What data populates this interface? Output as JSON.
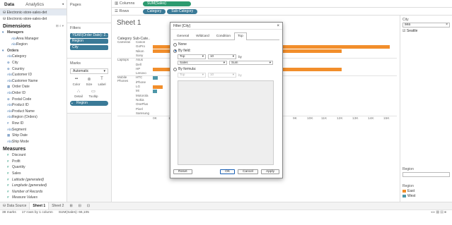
{
  "data_pane": {
    "tabs": [
      "Data",
      "Analytics"
    ],
    "datasources": [
      "Electronic-store-sales-det",
      "Electronic-store-sales-det"
    ],
    "dimensions_title": "Dimensions",
    "dimensions_tools": "⊞ ⌕ ▾",
    "dimension_fields": [
      {
        "label": "Managers",
        "kind": "group",
        "icon": "▾"
      },
      {
        "label": "Area Manager",
        "kind": "sub",
        "icon": "Abc"
      },
      {
        "label": "Region",
        "kind": "sub",
        "icon": "Abc"
      },
      {
        "label": "Orders",
        "kind": "group",
        "icon": "▾"
      },
      {
        "label": "Category",
        "kind": "field",
        "icon": "Abc"
      },
      {
        "label": "City",
        "kind": "field",
        "icon": "⊕"
      },
      {
        "label": "Country",
        "kind": "field",
        "icon": "⊕"
      },
      {
        "label": "Customer ID",
        "kind": "field",
        "icon": "Abc"
      },
      {
        "label": "Customer Name",
        "kind": "field",
        "icon": "Abc"
      },
      {
        "label": "Order Date",
        "kind": "field",
        "icon": "▦"
      },
      {
        "label": "Order ID",
        "kind": "field",
        "icon": "Abc"
      },
      {
        "label": "Postal Code",
        "kind": "field",
        "icon": "⊕"
      },
      {
        "label": "Product ID",
        "kind": "field",
        "icon": "Abc"
      },
      {
        "label": "Product Name",
        "kind": "field",
        "icon": "Abc"
      },
      {
        "label": "Region (Orders)",
        "kind": "field",
        "icon": "Abc"
      },
      {
        "label": "Row ID",
        "kind": "field",
        "icon": "#"
      },
      {
        "label": "Segment",
        "kind": "field",
        "icon": "Abc"
      },
      {
        "label": "Ship Date",
        "kind": "field",
        "icon": "▦"
      },
      {
        "label": "Ship Mode",
        "kind": "field",
        "icon": "Abc"
      }
    ],
    "measures_title": "Measures",
    "measure_fields": [
      {
        "label": "Discount",
        "italic": false
      },
      {
        "label": "Profit",
        "italic": false
      },
      {
        "label": "Quantity",
        "italic": false
      },
      {
        "label": "Sales",
        "italic": false
      },
      {
        "label": "Latitude (generated)",
        "italic": true
      },
      {
        "label": "Longitude (generated)",
        "italic": true
      },
      {
        "label": "Number of Records",
        "italic": true
      },
      {
        "label": "Measure Values",
        "italic": true
      }
    ]
  },
  "pages": {
    "title": "Pages"
  },
  "filters": {
    "title": "Filters",
    "pills": [
      "YEAR(Order Date): 2..",
      "Region",
      "City"
    ]
  },
  "marks": {
    "title": "Marks",
    "type": "Automatic",
    "buttons": [
      {
        "label": "Color",
        "icon": "▪▪"
      },
      {
        "label": "Size",
        "icon": "⊚"
      },
      {
        "label": "Label",
        "icon": "T"
      },
      {
        "label": "Detail",
        "icon": "∴"
      },
      {
        "label": "Tooltip",
        "icon": "▭"
      }
    ],
    "color_pill": "Region"
  },
  "shelves": {
    "columns_label": "Columns",
    "columns_pill": "SUM(Sales)",
    "rows_label": "Rows",
    "rows_pills": [
      "Category",
      "Sub-Category"
    ]
  },
  "view": {
    "sheet_title": "Sheet 1",
    "header_category": "Category",
    "header_subcategory": "Sub-Cate..",
    "groups": [
      {
        "name": "Cameras",
        "rows": [
          "Canon",
          "GoPro",
          "Nikon",
          "Sony"
        ]
      },
      {
        "name": "Laptops",
        "rows": [
          "Asus",
          "Dell",
          "HP",
          "Lenovo"
        ]
      },
      {
        "name": "Mobile Phones",
        "rows": [
          "HTC",
          "iPhone",
          "LG",
          "Mi",
          "Motorola",
          "Nokia",
          "OnePlus",
          "Pixel",
          "Samsung"
        ]
      }
    ],
    "x_ticks": [
      "0K",
      "1K",
      "9K",
      "10K",
      "11K",
      "12K",
      "13K",
      "14K",
      "15K"
    ]
  },
  "chart_data": {
    "type": "bar",
    "title": "",
    "xlabel": "",
    "ylabel": "",
    "categories": [
      "Canon",
      "GoPro",
      "Nikon",
      "Sony",
      "Asus",
      "Dell",
      "HP",
      "Lenovo",
      "HTC",
      "iPhone",
      "LG",
      "Mi",
      "Motorola",
      "Nokia",
      "OnePlus",
      "Pixel",
      "Samsung"
    ],
    "series": [
      {
        "name": "East",
        "values": [
          0,
          14800,
          11800,
          0,
          0,
          0,
          11800,
          0,
          0,
          0,
          600,
          0,
          0,
          0,
          0,
          0,
          0
        ]
      },
      {
        "name": "West",
        "values": [
          0,
          0,
          0,
          0,
          0,
          0,
          0,
          0,
          300,
          0,
          0,
          250,
          0,
          0,
          0,
          0,
          0
        ]
      }
    ],
    "colors": {
      "East": "#f28e2b",
      "West": "#4e97a8"
    }
  },
  "legend": {
    "city_title": "City",
    "city_search": "sea",
    "city_value": "Seattle",
    "region_title": "Region",
    "region_items": [
      {
        "name": "East",
        "color": "#f28e2b"
      },
      {
        "name": "West",
        "color": "#4e97a8"
      }
    ]
  },
  "sheet_tabs": {
    "items": [
      "Data Source",
      "Sheet 1",
      "Sheet 2"
    ],
    "active": "Sheet 1"
  },
  "status": {
    "marks": "38 marks",
    "rows_cols": "17 rows by 1 column",
    "sum": "SUM(Sales): 66,105"
  },
  "dialog": {
    "title": "Filter [City]",
    "tabs": [
      "General",
      "Wildcard",
      "Condition",
      "Top"
    ],
    "active_tab": "Top",
    "opt_none": "None",
    "opt_by_field": "By field:",
    "by_field_direction": "Top",
    "by_field_count": "10",
    "by_field_by": "by",
    "by_field_measure": "Sales",
    "by_field_agg": "Sum",
    "opt_by_formula": "By formula:",
    "formula_direction": "Top",
    "formula_count": "10",
    "formula_by": "by",
    "btn_reset": "Reset",
    "btn_ok": "OK",
    "btn_cancel": "Cancel",
    "btn_apply": "Apply"
  }
}
